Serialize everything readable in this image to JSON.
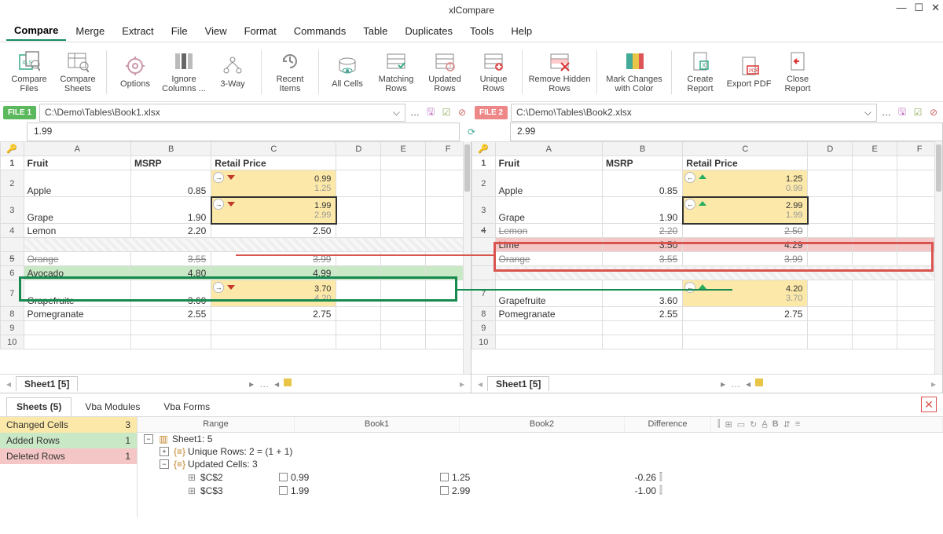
{
  "app_title": "xlCompare",
  "menu": [
    "Compare",
    "Merge",
    "Extract",
    "File",
    "View",
    "Format",
    "Commands",
    "Table",
    "Duplicates",
    "Tools",
    "Help"
  ],
  "menu_active": 0,
  "ribbon": [
    {
      "id": "compare-files",
      "label": "Compare Files"
    },
    {
      "id": "compare-sheets",
      "label": "Compare Sheets"
    },
    {
      "id": "options",
      "label": "Options"
    },
    {
      "id": "ignore-columns",
      "label": "Ignore Columns ..."
    },
    {
      "id": "3way",
      "label": "3-Way"
    },
    {
      "id": "recent-items",
      "label": "Recent Items"
    },
    {
      "id": "all-cells",
      "label": "All Cells"
    },
    {
      "id": "matching-rows",
      "label": "Matching Rows"
    },
    {
      "id": "updated-rows",
      "label": "Updated Rows"
    },
    {
      "id": "unique-rows",
      "label": "Unique Rows"
    },
    {
      "id": "remove-hidden",
      "label": "Remove Hidden Rows"
    },
    {
      "id": "mark-changes",
      "label": "Mark Changes with Color"
    },
    {
      "id": "create-report",
      "label": "Create Report"
    },
    {
      "id": "export-pdf",
      "label": "Export PDF"
    },
    {
      "id": "close-report",
      "label": "Close Report"
    }
  ],
  "file1": {
    "tag": "FILE 1",
    "path": "C:\\Demo\\Tables\\Book1.xlsx",
    "formula": "1.99"
  },
  "file2": {
    "tag": "FILE 2",
    "path": "C:\\Demo\\Tables\\Book2.xlsx",
    "formula": "2.99"
  },
  "columns": [
    "A",
    "B",
    "C",
    "D",
    "E",
    "F"
  ],
  "headers": {
    "a": "Fruit",
    "b": "MSRP",
    "c": "Retail Price"
  },
  "left_rows": [
    {
      "n": "1",
      "type": "header"
    },
    {
      "n": "2",
      "a": "Apple",
      "b": "0.85",
      "c_top": "0.99",
      "c_bot": "1.25",
      "dir": "down",
      "sel": false
    },
    {
      "n": "3",
      "a": "Grape",
      "b": "1.90",
      "c_top": "1.99",
      "c_bot": "2.99",
      "dir": "down",
      "sel": true
    },
    {
      "n": "4",
      "a": "Lemon",
      "b": "2.20",
      "c": "2.50"
    },
    {
      "n": "",
      "type": "hatch"
    },
    {
      "n": "5",
      "a": "Orange",
      "b": "3.55",
      "c": "3.99",
      "strike": true
    },
    {
      "n": "6",
      "a": "Avocado",
      "b": "4.80",
      "c": "4.99",
      "added": true
    },
    {
      "n": "7",
      "a": "Grapefruite",
      "b": "3.60",
      "c_top": "3.70",
      "c_bot": "4.20",
      "dir": "down",
      "botfade": true
    },
    {
      "n": "8",
      "a": "Pomegranate",
      "b": "2.55",
      "c": "2.75"
    },
    {
      "n": "9"
    },
    {
      "n": "10"
    }
  ],
  "right_rows": [
    {
      "n": "1",
      "type": "header"
    },
    {
      "n": "2",
      "a": "Apple",
      "b": "0.85",
      "c_top": "1.25",
      "c_bot": "0.99",
      "dir": "up"
    },
    {
      "n": "3",
      "a": "Grape",
      "b": "1.90",
      "c_top": "2.99",
      "c_bot": "1.99",
      "dir": "up",
      "sel": true
    },
    {
      "n": "4",
      "a": "Lemon",
      "b": "2.20",
      "c": "2.50",
      "strike": true
    },
    {
      "n": "",
      "a": "Lime",
      "b": "3.50",
      "c": "4.29",
      "deleted": true
    },
    {
      "n": "",
      "a": "Orange",
      "b": "3.55",
      "c": "3.99",
      "strike": true
    },
    {
      "n": "",
      "type": "hatch"
    },
    {
      "n": "7",
      "a": "Grapefruite",
      "b": "3.60",
      "c_top": "4.20",
      "c_bot": "3.70",
      "dir": "up",
      "botfade": true
    },
    {
      "n": "8",
      "a": "Pomegranate",
      "b": "2.55",
      "c": "2.75"
    },
    {
      "n": "9"
    },
    {
      "n": "10"
    }
  ],
  "sheet_tab": "Sheet1 [5]",
  "bottom_tabs": [
    "Sheets (5)",
    "Vba Modules",
    "Vba Forms"
  ],
  "summary": {
    "changed_label": "Changed Cells",
    "changed": "3",
    "added_label": "Added Rows",
    "added": "1",
    "deleted_label": "Deleted Rows",
    "deleted": "1"
  },
  "detail_cols": {
    "range": "Range",
    "book1": "Book1",
    "book2": "Book2",
    "diff": "Difference"
  },
  "details": {
    "sheet": "Sheet1: 5",
    "unique": "Unique Rows: 2 = (1 + 1)",
    "updated": "Updated Cells: 3",
    "r1": {
      "range": "$C$2",
      "b1": "0.99",
      "b2": "1.25",
      "d": "-0.26"
    },
    "r2": {
      "range": "$C$3",
      "b1": "1.99",
      "b2": "2.99",
      "d": "-1.00"
    }
  }
}
